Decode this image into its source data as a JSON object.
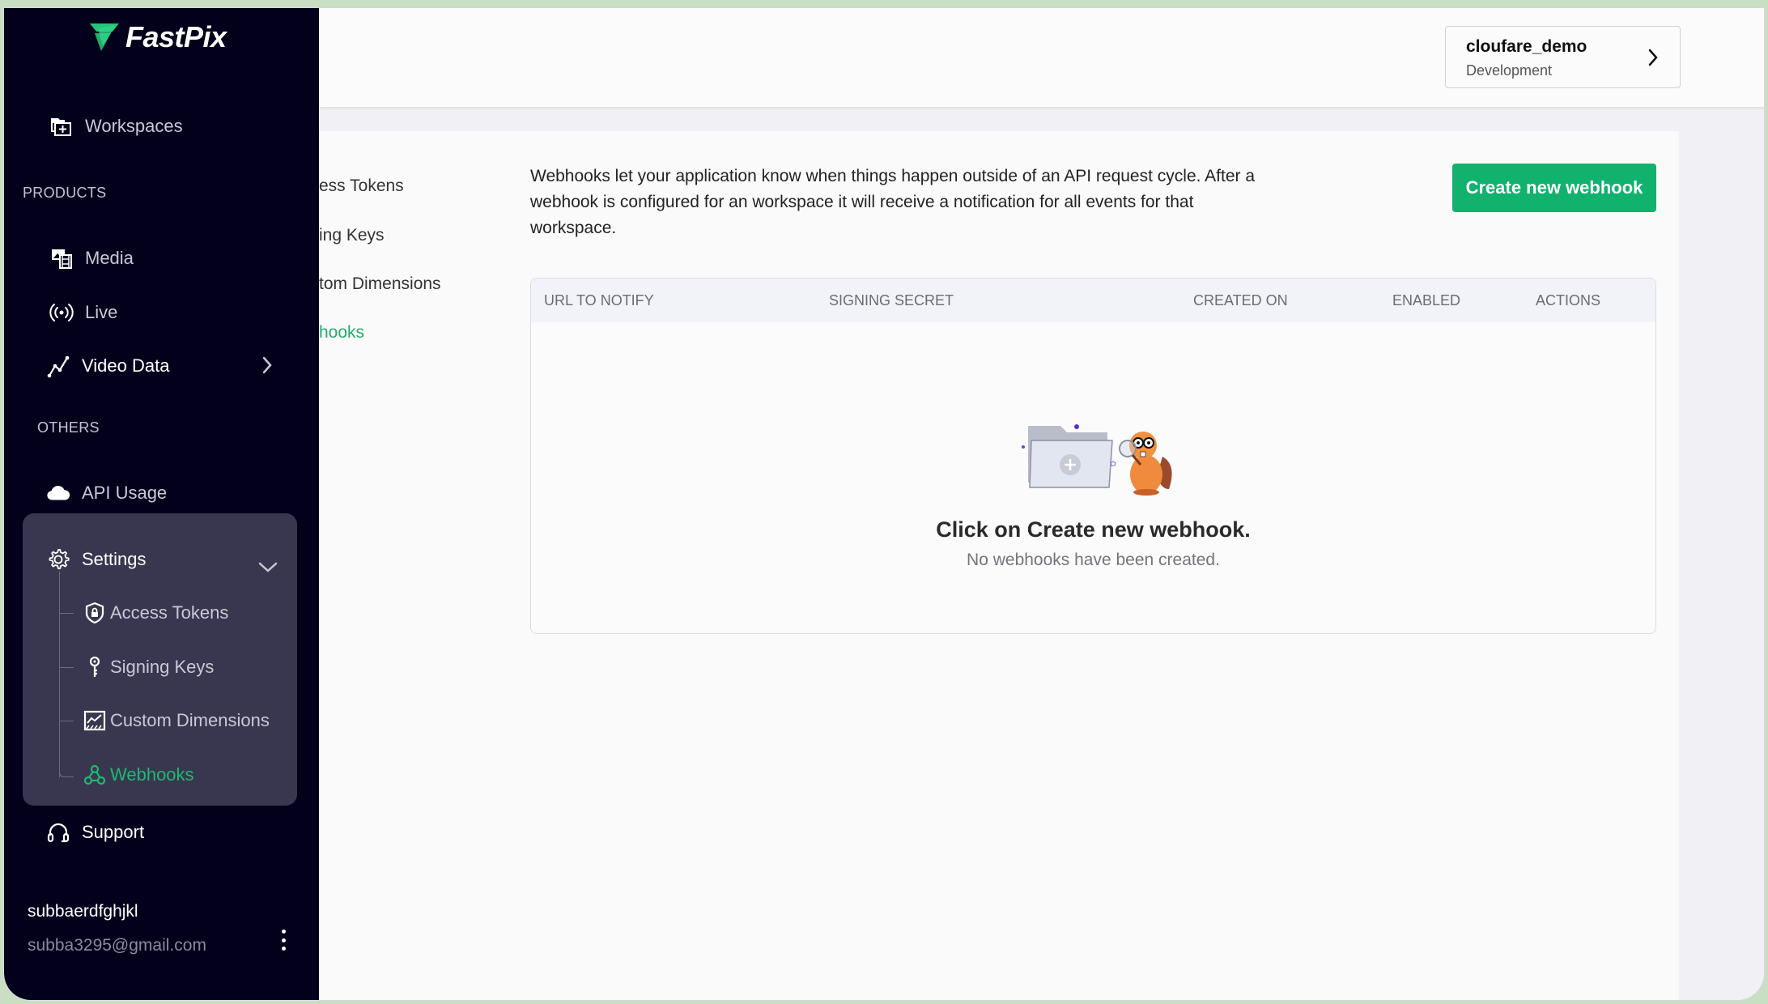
{
  "brand": {
    "name": "FastPix",
    "accent": "#1fb872"
  },
  "sidebar": {
    "workspaces_label": "Workspaces",
    "products_heading": "PRODUCTS",
    "products": [
      {
        "label": "Media",
        "icon": "media-icon"
      },
      {
        "label": "Live",
        "icon": "live-broadcast-icon"
      },
      {
        "label": "Video Data",
        "icon": "chart-line-icon"
      }
    ],
    "others_heading": "OTHERS",
    "others": [
      {
        "label": "API Usage",
        "icon": "cloud-icon"
      }
    ],
    "settings": {
      "label": "Settings",
      "expanded": true,
      "items": [
        {
          "label": "Access Tokens",
          "icon": "shield-lock-icon"
        },
        {
          "label": "Signing Keys",
          "icon": "key-icon"
        },
        {
          "label": "Custom Dimensions",
          "icon": "dimensions-chart-icon"
        },
        {
          "label": "Webhooks",
          "icon": "webhook-icon",
          "active": true
        }
      ]
    },
    "support_label": "Support",
    "user": {
      "name": "subbaerdfghjkl",
      "email": "subba3295@gmail.com"
    }
  },
  "header": {
    "workspace": {
      "name": "cloufare_demo",
      "environment": "Development"
    }
  },
  "subnav": {
    "items": [
      {
        "label": "ess Tokens"
      },
      {
        "label": "ing Keys"
      },
      {
        "label": "tom Dimensions"
      },
      {
        "label": "hooks",
        "active": true
      }
    ]
  },
  "main": {
    "description": "Webhooks let your application know when things happen outside of an API request cycle. After a webhook is configured for an workspace it will receive a notification for all events for that workspace.",
    "create_button_label": "Create new webhook",
    "table": {
      "columns": [
        "URL TO NOTIFY",
        "SIGNING SECRET",
        "CREATED ON",
        "ENABLED",
        "ACTIONS"
      ],
      "rows": []
    },
    "empty_state": {
      "title": "Click on Create new webhook.",
      "subtitle": "No webhooks have been created."
    }
  }
}
